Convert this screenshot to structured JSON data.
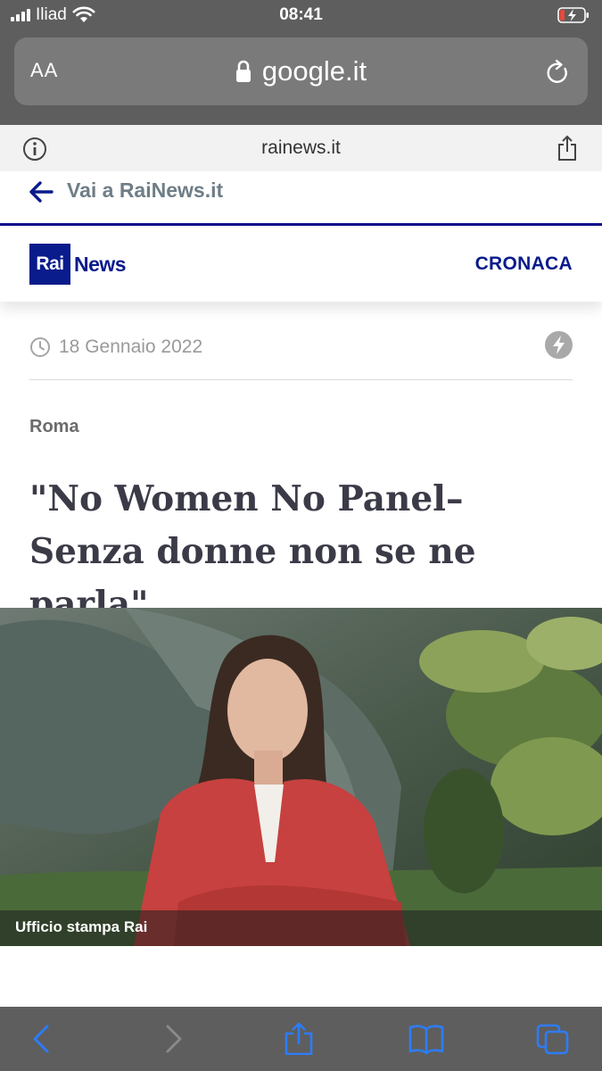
{
  "status": {
    "carrier": "Iliad",
    "time": "08:41"
  },
  "url_bar": {
    "text_size_label": "AA",
    "domain": "google.it"
  },
  "amp": {
    "domain": "rainews.it",
    "back_label": "Vai a RaiNews.it"
  },
  "site": {
    "logo_rai": "Rai",
    "logo_news": "News",
    "section": "CRONACA",
    "brand_color": "#0a1b8c"
  },
  "article": {
    "date": "18 Gennaio 2022",
    "location": "Roma",
    "headline": "\"No Women No Panel–Senza donne non se ne parla\"",
    "image_caption": "Ufficio stampa Rai"
  },
  "toolbar": {
    "icons": [
      "back-icon",
      "forward-icon",
      "share-icon",
      "bookmarks-icon",
      "tabs-icon"
    ]
  }
}
